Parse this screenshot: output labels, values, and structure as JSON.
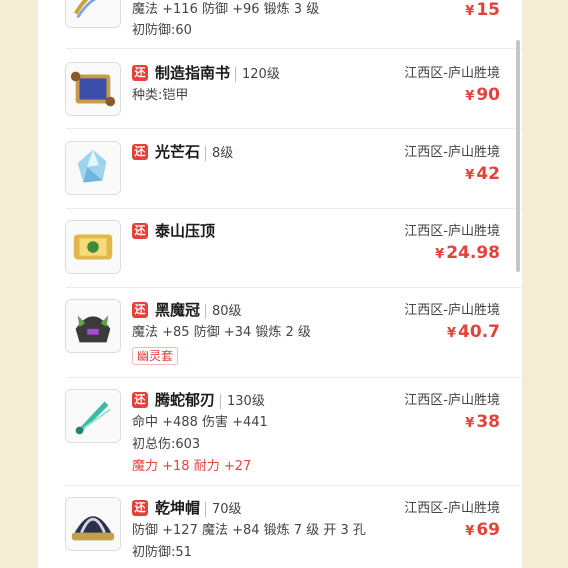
{
  "items": [
    {
      "name": "",
      "level": "",
      "server": "",
      "price": "15",
      "stats": "魔法 +116 防御 +96 锻炼 3 级",
      "extra": "初防御:60",
      "bonus": "",
      "tag": ""
    },
    {
      "name": "制造指南书",
      "level": "120级",
      "server": "江西区-庐山胜境",
      "price": "90",
      "stats": "种类:铠甲",
      "extra": "",
      "bonus": "",
      "tag": ""
    },
    {
      "name": "光芒石",
      "level": "8级",
      "server": "江西区-庐山胜境",
      "price": "42",
      "stats": "",
      "extra": "",
      "bonus": "",
      "tag": ""
    },
    {
      "name": "泰山压顶",
      "level": "",
      "server": "江西区-庐山胜境",
      "price": "24.98",
      "stats": "",
      "extra": "",
      "bonus": "",
      "tag": ""
    },
    {
      "name": "黑魔冠",
      "level": "80级",
      "server": "江西区-庐山胜境",
      "price": "40.7",
      "stats": "魔法 +85 防御 +34 锻炼 2 级",
      "extra": "",
      "bonus": "",
      "tag": "幽灵套"
    },
    {
      "name": "腾蛇郁刃",
      "level": "130级",
      "server": "江西区-庐山胜境",
      "price": "38",
      "stats": "命中 +488 伤害 +441",
      "extra": "初总伤:603",
      "bonus": "魔力 +18 耐力 +27",
      "tag": ""
    },
    {
      "name": "乾坤帽",
      "level": "70级",
      "server": "江西区-庐山胜境",
      "price": "69",
      "stats": "防御 +127 魔法 +84 锻炼 7 级 开 3 孔",
      "extra": "初防御:51",
      "bonus": "",
      "tag": ""
    }
  ],
  "badge_label": "还",
  "currency": "¥",
  "colors": {
    "accent": "#e5413b",
    "background": "#f5ecd6"
  },
  "icons": [
    "jade-ornament-icon",
    "guide-scroll-icon",
    "crystal-icon",
    "gold-scroll-icon",
    "helmet-icon",
    "blade-icon",
    "hat-icon"
  ]
}
